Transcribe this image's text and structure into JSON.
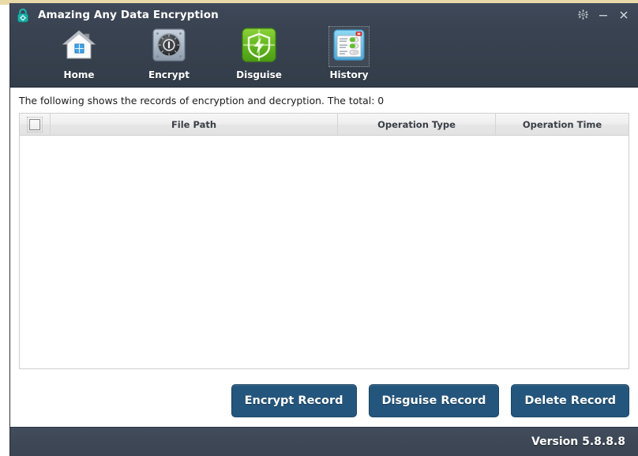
{
  "window": {
    "title": "Amazing Any Data Encryption",
    "logo_icon": "padlock-icon",
    "controls": [
      {
        "name": "settings-button",
        "icon": "gear-icon",
        "label": "Settings"
      },
      {
        "name": "minimize-button",
        "icon": "minimize-icon",
        "label": "Minimize"
      },
      {
        "name": "close-button",
        "icon": "close-icon",
        "label": "Close"
      }
    ]
  },
  "toolbar": {
    "items": [
      {
        "label": "Home",
        "icon": "house-icon",
        "selected": false
      },
      {
        "label": "Encrypt",
        "icon": "safe-lock-icon",
        "selected": false
      },
      {
        "label": "Disguise",
        "icon": "shield-bolt-icon",
        "selected": false
      },
      {
        "label": "History",
        "icon": "history-window-icon",
        "selected": true
      }
    ]
  },
  "content": {
    "info_text": "The following shows the records of encryption and decryption. The total: 0",
    "total": 0
  },
  "table": {
    "select_all_checked": false,
    "columns": [
      "",
      "File Path",
      "Operation Type",
      "Operation Time"
    ],
    "rows": []
  },
  "actions": {
    "buttons": [
      {
        "label": "Encrypt Record",
        "name": "encrypt-record-button"
      },
      {
        "label": "Disguise Record",
        "name": "disguise-record-button"
      },
      {
        "label": "Delete Record",
        "name": "delete-record-button"
      }
    ]
  },
  "footer": {
    "version_label": "Version 5.8.8.8"
  },
  "desktop": {
    "sliver_text": "\n\n\n\n\n\n\n\n\n\n\n\n\n\n\n\n\n\n\n\n\n\n"
  },
  "colors": {
    "titlebar": "#3b4654",
    "toolbar": "#36404d",
    "button": "#24567d",
    "footer": "#3f4a5a",
    "accent_teal": "#16b0a8",
    "accent_green": "#5fb521"
  }
}
